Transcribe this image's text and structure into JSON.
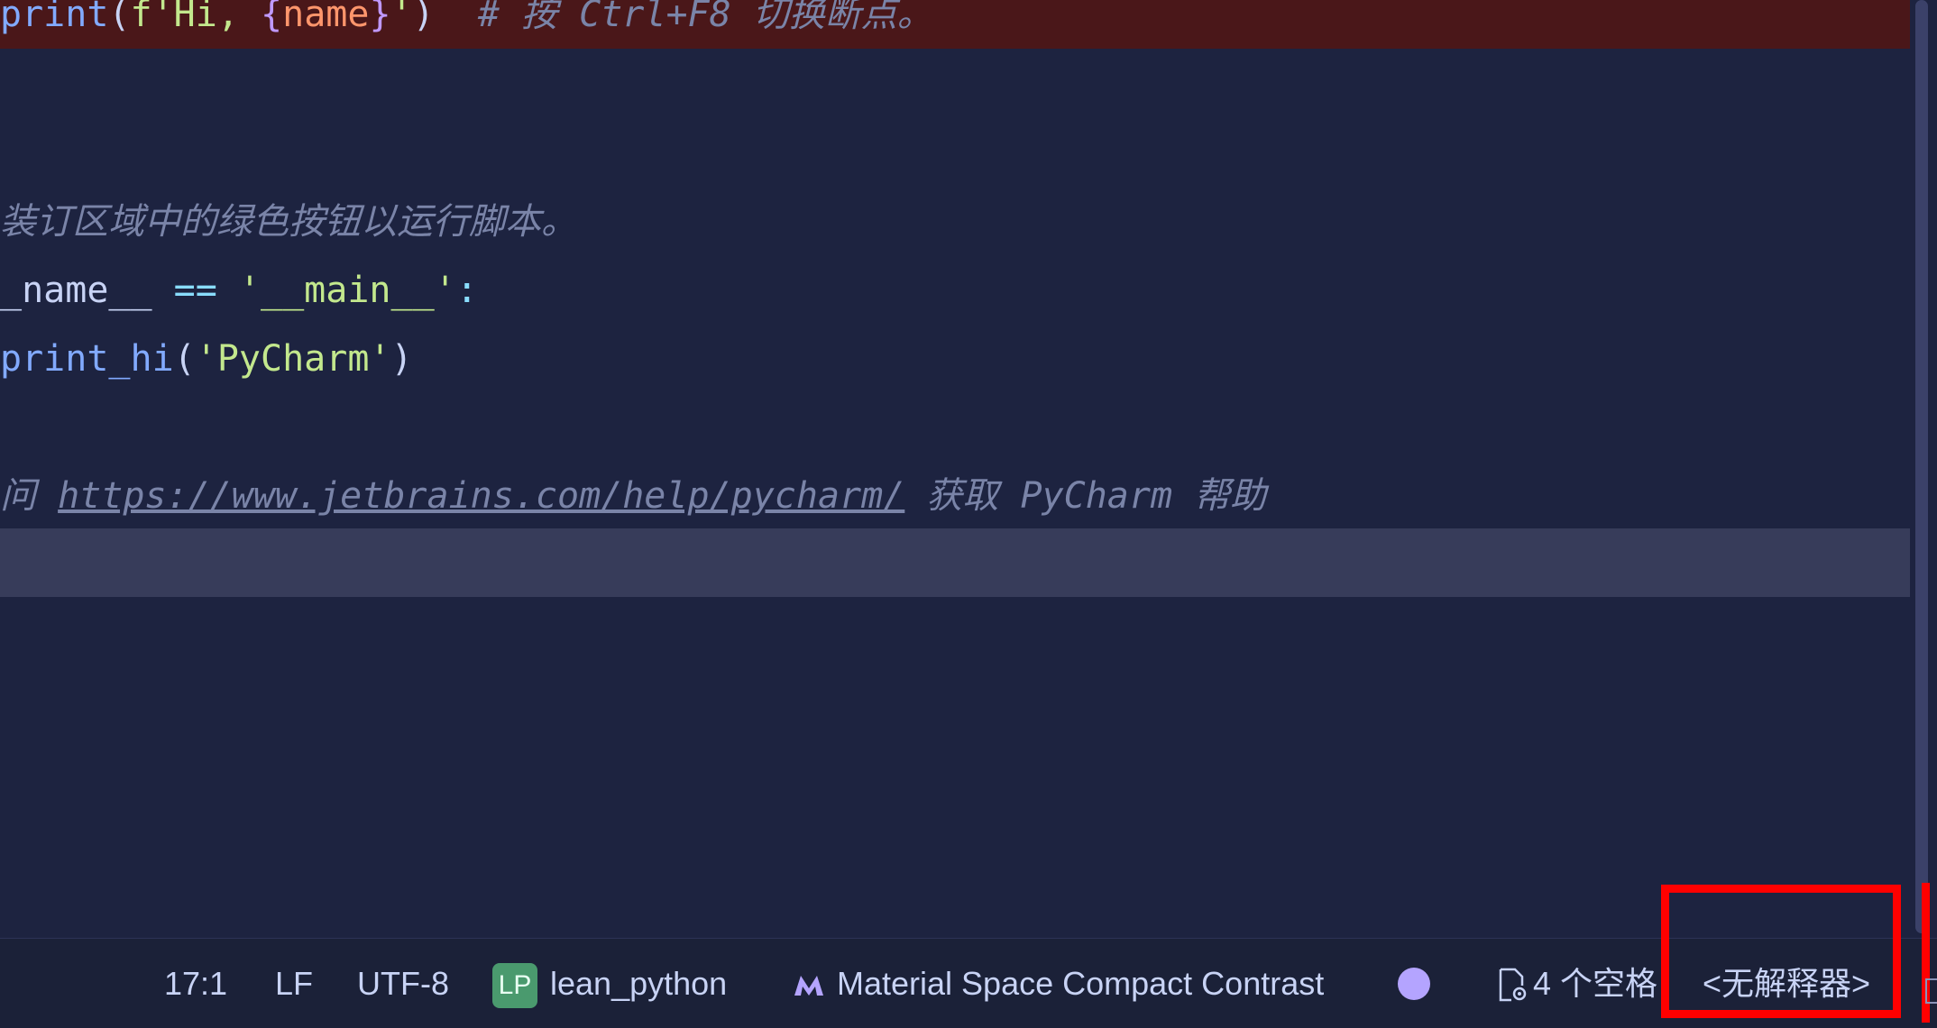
{
  "editor": {
    "lines": {
      "l1": {
        "fn": "print",
        "open_paren": "(",
        "str_prefix": "f'Hi, ",
        "brace_open": "{",
        "var": "name",
        "brace_close": "}",
        "str_suffix": "'",
        "close_paren": ")",
        "comment": "  # 按 Ctrl+F8 切换断点。"
      },
      "l4": {
        "comment": "装订区域中的绿色按钮以运行脚本。"
      },
      "l5": {
        "ident": "_name__ ",
        "op": "==",
        "str": " '__main__'",
        "colon": ":"
      },
      "l6": {
        "fn": "print_hi",
        "open_paren": "(",
        "str": "'PyCharm'",
        "close_paren": ")"
      },
      "l8": {
        "comment_prefix": "问 ",
        "link": "https://www.jetbrains.com/help/pycharm/",
        "comment_suffix": " 获取 PyCharm 帮助"
      }
    }
  },
  "statusbar": {
    "position": "17:1",
    "line_separator": "LF",
    "encoding": "UTF-8",
    "project_badge": "LP",
    "project_name": "lean_python",
    "theme_icon": "material-theme-icon",
    "theme_name": "Material Space Compact Contrast",
    "indicator_color": "#b4a4ff",
    "indent_icon": "file-settings-icon",
    "indent": "4 个空格",
    "interpreter": "<无解释器>"
  },
  "colors": {
    "editor_bg": "#1d2340",
    "breakpoint_line": "#4a1719",
    "current_line": "#373c5a",
    "highlight": "#ff0000"
  }
}
